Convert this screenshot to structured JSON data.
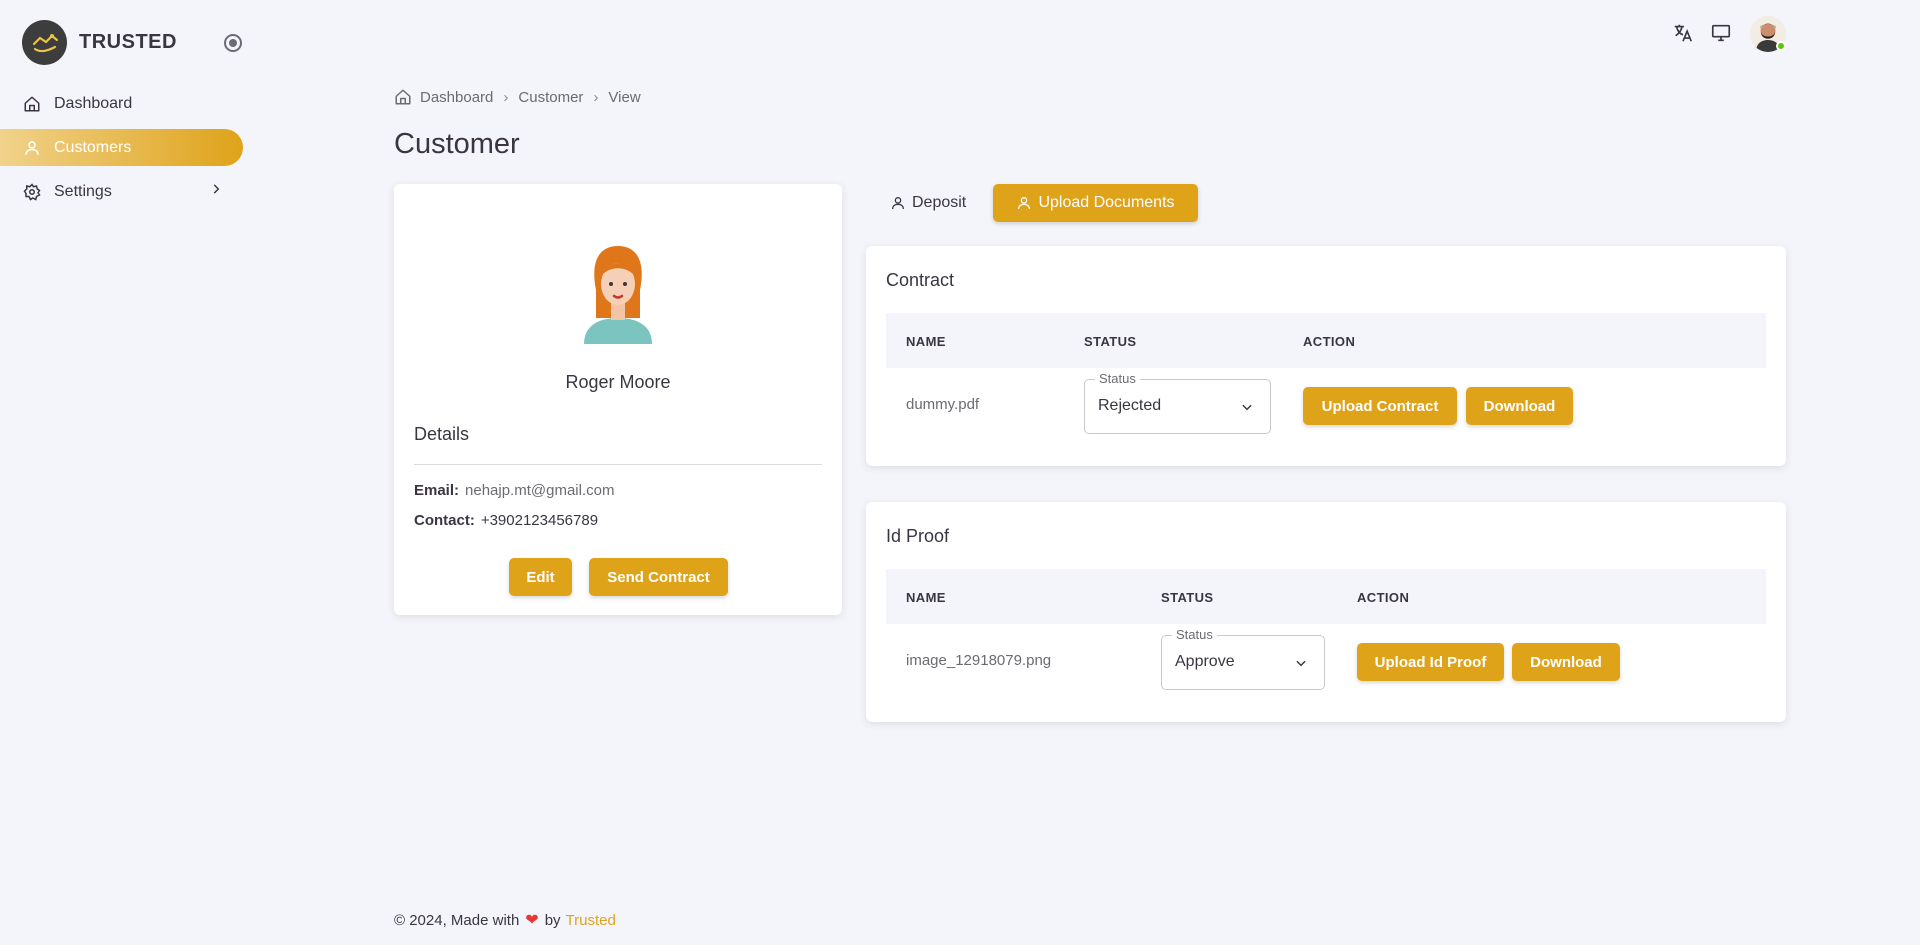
{
  "app": {
    "brand": "TRUSTED"
  },
  "sidebar": {
    "items": [
      {
        "label": "Dashboard",
        "icon": "home-icon"
      },
      {
        "label": "Customers",
        "icon": "user-icon",
        "active": true
      },
      {
        "label": "Settings",
        "icon": "settings-icon"
      }
    ]
  },
  "breadcrumb": [
    "Dashboard",
    "Customer",
    "View"
  ],
  "breadcrumb_separator": "›",
  "page": {
    "title": "Customer"
  },
  "profile": {
    "name": "Roger Moore",
    "details_title": "Details",
    "email_label": "Email:",
    "email": "nehajp.mt@gmail.com",
    "contact_label": "Contact:",
    "contact": "+3902123456789",
    "edit_label": "Edit",
    "send_contract_label": "Send Contract"
  },
  "tabs": [
    {
      "label": "Deposit",
      "active": false
    },
    {
      "label": "Upload Documents",
      "active": true
    }
  ],
  "contract": {
    "title": "Contract",
    "columns": [
      "NAME",
      "STATUS",
      "ACTION"
    ],
    "file": "dummy.pdf",
    "status_legend": "Status",
    "status": "Rejected",
    "upload_label": "Upload Contract",
    "download_label": "Download"
  },
  "id_proof": {
    "title": "Id Proof",
    "columns": [
      "NAME",
      "STATUS",
      "ACTION"
    ],
    "file": "image_12918079.png",
    "status_legend": "Status",
    "status": "Approve",
    "upload_label": "Upload Id Proof",
    "download_label": "Download"
  },
  "footer": {
    "text": "© 2024, Made with",
    "by": "by",
    "brand": "Trusted"
  },
  "colors": {
    "accent": "#dfa31a",
    "background": "#f4f5fa",
    "online": "#56ca00"
  }
}
